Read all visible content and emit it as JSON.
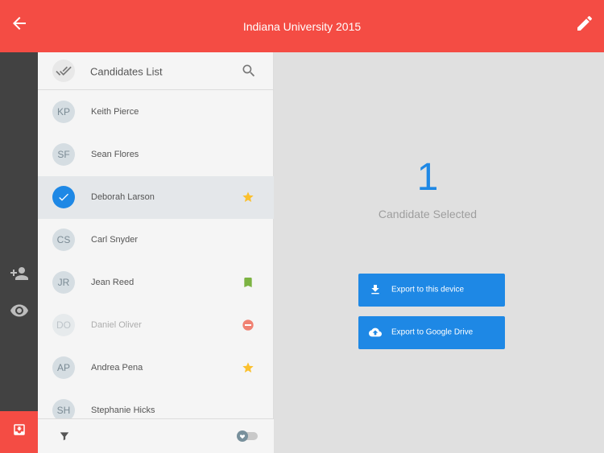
{
  "header": {
    "title": "Indiana University 2015"
  },
  "colors": {
    "accent": "#f44c44",
    "primary": "#1e88e5",
    "rail": "#424242",
    "star": "#fbc02d",
    "bookmark": "#7cb342",
    "remove": "#ef6c5a"
  },
  "panel": {
    "title": "Candidates List"
  },
  "candidates": [
    {
      "initials": "KP",
      "name": "Keith Pierce",
      "mark": ""
    },
    {
      "initials": "SF",
      "name": "Sean Flores",
      "mark": ""
    },
    {
      "initials": "",
      "name": "Deborah Larson",
      "mark": "star-icon",
      "selected": true
    },
    {
      "initials": "CS",
      "name": "Carl Snyder",
      "mark": ""
    },
    {
      "initials": "JR",
      "name": "Jean Reed",
      "mark": "bookmark-icon"
    },
    {
      "initials": "DO",
      "name": "Daniel Oliver",
      "mark": "remove-icon",
      "faded": true
    },
    {
      "initials": "AP",
      "name": "Andrea Pena",
      "mark": "star-icon"
    },
    {
      "initials": "SH",
      "name": "Stephanie Hicks",
      "mark": ""
    }
  ],
  "summary": {
    "count": "1",
    "label": "Candidate Selected"
  },
  "actions": {
    "export_device": "Export to this device",
    "export_drive": "Export to Google Drive"
  }
}
